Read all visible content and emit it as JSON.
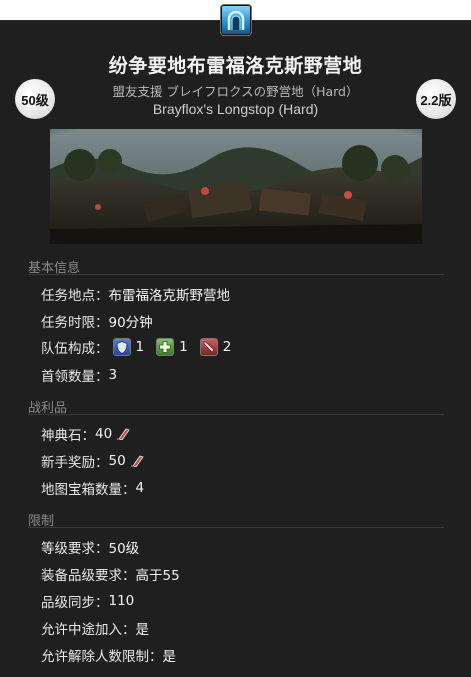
{
  "header": {
    "badge_level": "50级",
    "badge_patch": "2.2版",
    "title": "纷争要地布雷福洛克斯野营地",
    "subtitle_jp": "盟友支援 ブレイフロクスの野営地（Hard）",
    "subtitle_en": "Brayflox's Longstop (Hard)",
    "icon": "dungeon-portal-icon",
    "icon_color": "#2a93cf"
  },
  "basic_info": {
    "section_title": "基本信息",
    "location_label": "任务地点：",
    "location_value": "布雷福洛克斯野营地",
    "time_label": "任务时限：",
    "time_value": "90分钟",
    "party_label": "队伍构成：",
    "party": [
      {
        "role": "tank",
        "icon": "tank-shield-icon",
        "count": "1",
        "color": "#3f61c0"
      },
      {
        "role": "healer",
        "icon": "healer-cross-icon",
        "count": "1",
        "color": "#5aa63a"
      },
      {
        "role": "dps",
        "icon": "dps-sword-icon",
        "count": "2",
        "color": "#b04040"
      }
    ],
    "boss_label": "首领数量：",
    "boss_value": "3"
  },
  "loot": {
    "section_title": "战利品",
    "tomestone_label": "神典石：",
    "tomestone_value": "40",
    "rookie_label": "新手奖励：",
    "rookie_value": "50",
    "map_label": "地图宝箱数量：",
    "map_value": "4",
    "currency_icon": "tomestone-icon"
  },
  "restrictions": {
    "section_title": "限制",
    "level_label": "等级要求：",
    "level_value": "50级",
    "ilvl_label": "装备品级要求：",
    "ilvl_value": "高于55",
    "sync_label": "品级同步：",
    "sync_value": "110",
    "join_label": "允许中途加入：",
    "join_value": "是",
    "unrestricted_label": "允许解除人数限制：",
    "unrestricted_value": "是"
  }
}
